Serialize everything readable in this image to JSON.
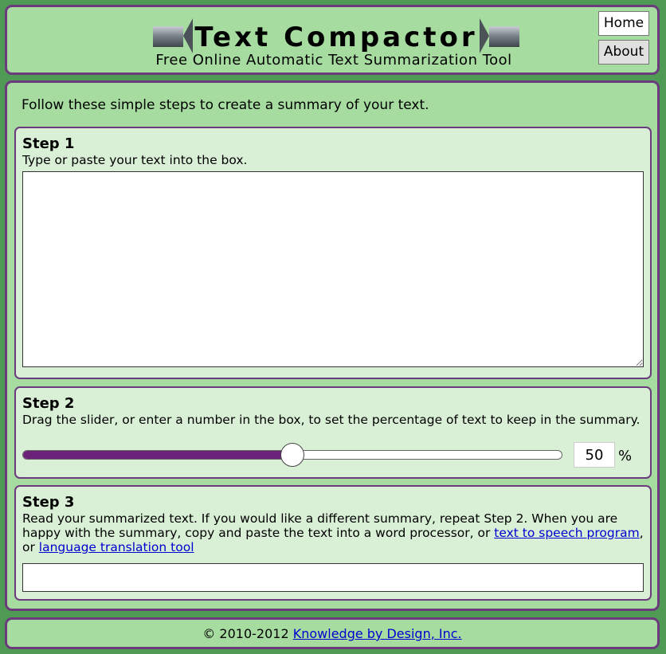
{
  "header": {
    "title": "Text Compactor",
    "subtitle": "Free Online Automatic Text Summarization Tool",
    "nav": {
      "home_label": "Home",
      "about_label": "About"
    }
  },
  "main": {
    "intro": "Follow these simple steps to create a summary of your text.",
    "step1": {
      "title": "Step 1",
      "instruction": "Type or paste your text into the box.",
      "input_value": ""
    },
    "step2": {
      "title": "Step 2",
      "instruction": "Drag the slider, or enter a number in the box, to set the percentage of text to keep in the summary.",
      "slider_fraction": 0.5,
      "percent_value": "50",
      "percent_sign": "%",
      "accent_color": "#6a2378"
    },
    "step3": {
      "title": "Step 3",
      "instruction_part1": "Read your summarized text. If you would like a different summary, repeat Step 2. When you are happy with the summary, copy and paste the text into a word processor, or ",
      "link1": "text to speech program",
      "instruction_part2": ", or ",
      "link2": "language translation tool",
      "output_value": ""
    }
  },
  "footer": {
    "copyright": "© 2010-2012 ",
    "link": "Knowledge by Design, Inc."
  },
  "colors": {
    "page_bg": "#4f9a55",
    "panel_bg": "#a6dca0",
    "step_bg": "#d9f0d6",
    "border": "#6c3b7e",
    "link": "#0000d0"
  }
}
